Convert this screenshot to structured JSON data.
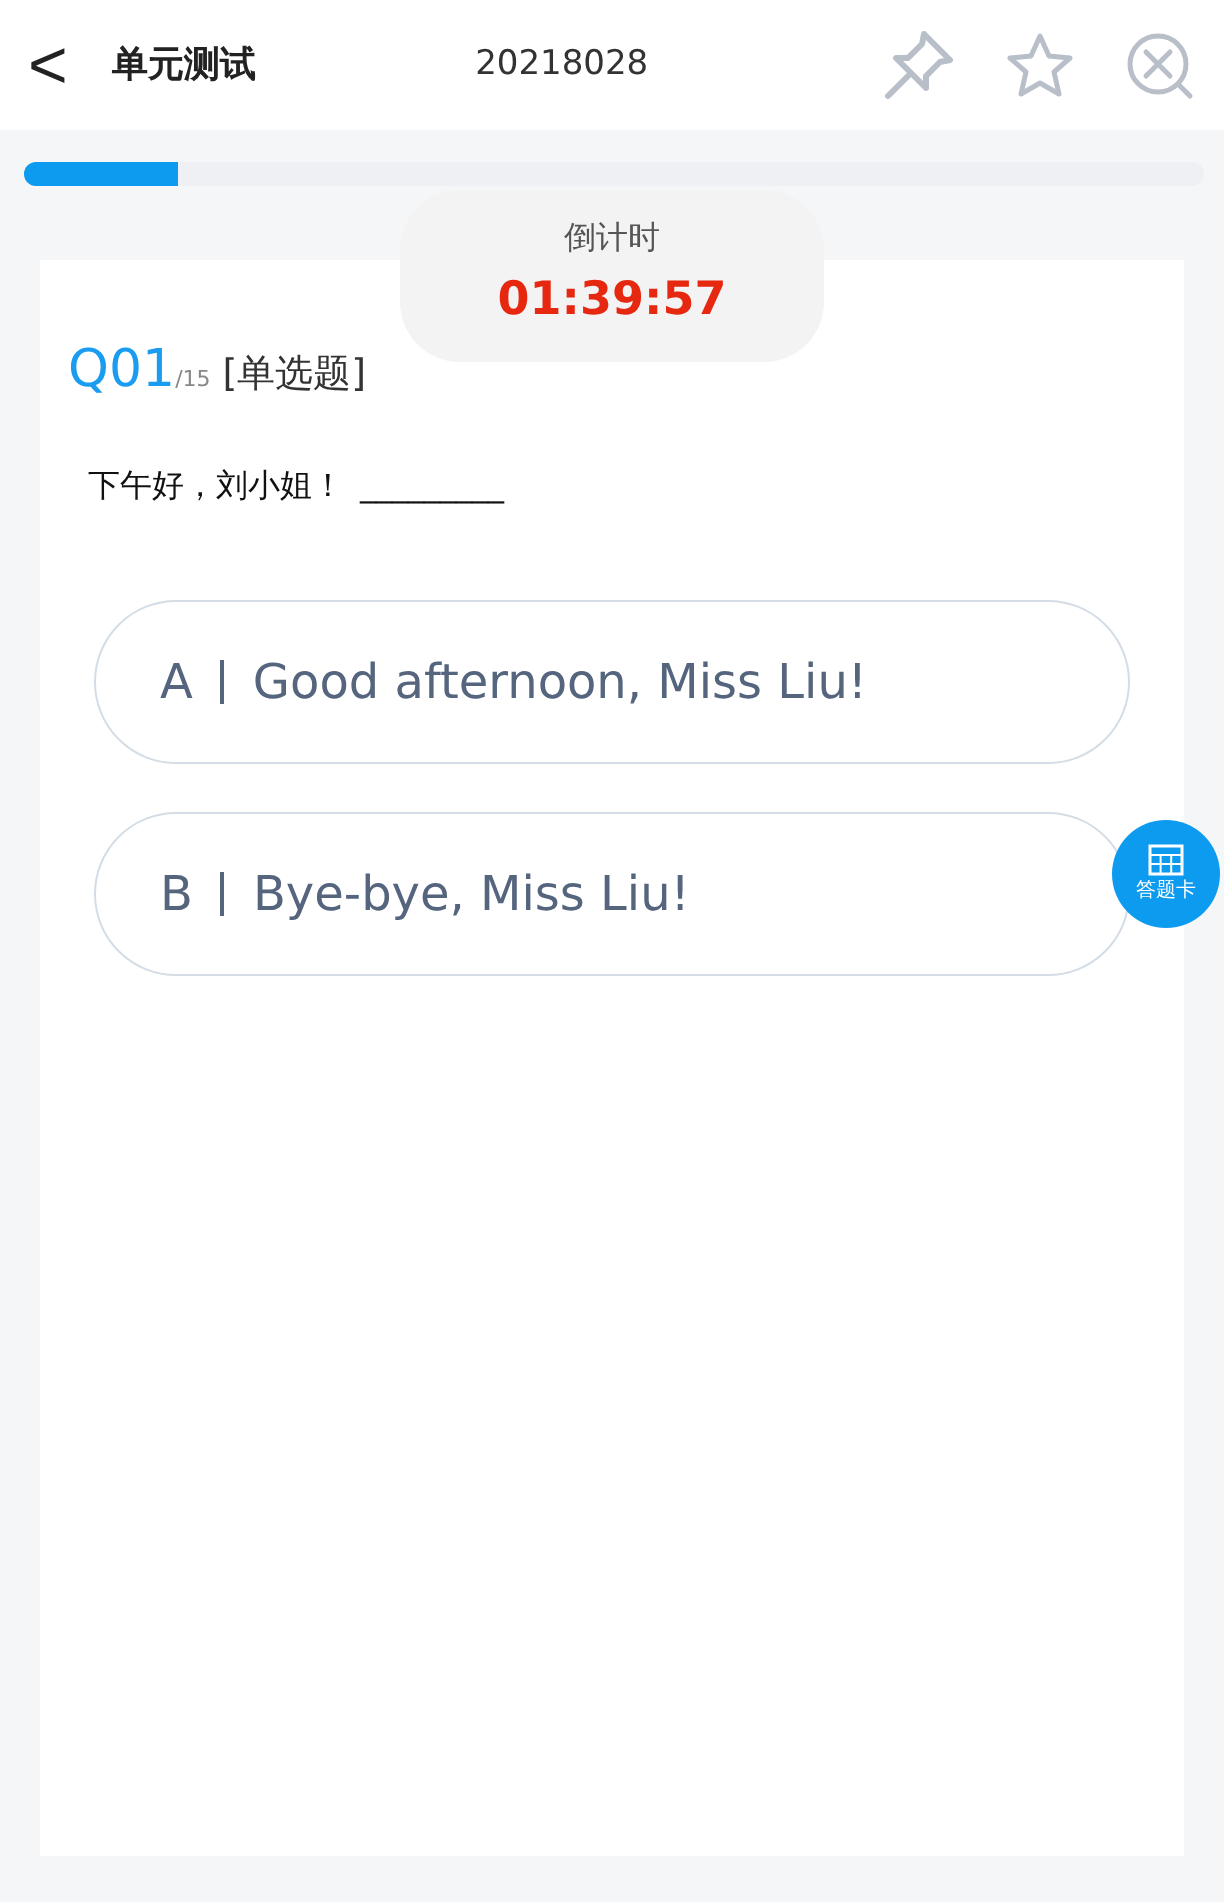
{
  "header": {
    "back": "<",
    "title": "单元测试",
    "code": "20218028"
  },
  "progress": {
    "level": 0.13
  },
  "timer": {
    "label": "倒计时",
    "time": "01:39:57"
  },
  "question": {
    "number": "Q01",
    "total": "/15",
    "type": "[单选题]",
    "prompt": "下午好，刘小姐！",
    "blank": "_________"
  },
  "options": [
    {
      "letter": "A",
      "text": "Good afternoon, Miss Liu!",
      "selected": false
    },
    {
      "letter": "B",
      "text": "Bye-bye, Miss Liu!",
      "selected": false
    }
  ],
  "answer_card": {
    "label": "答题卡"
  }
}
